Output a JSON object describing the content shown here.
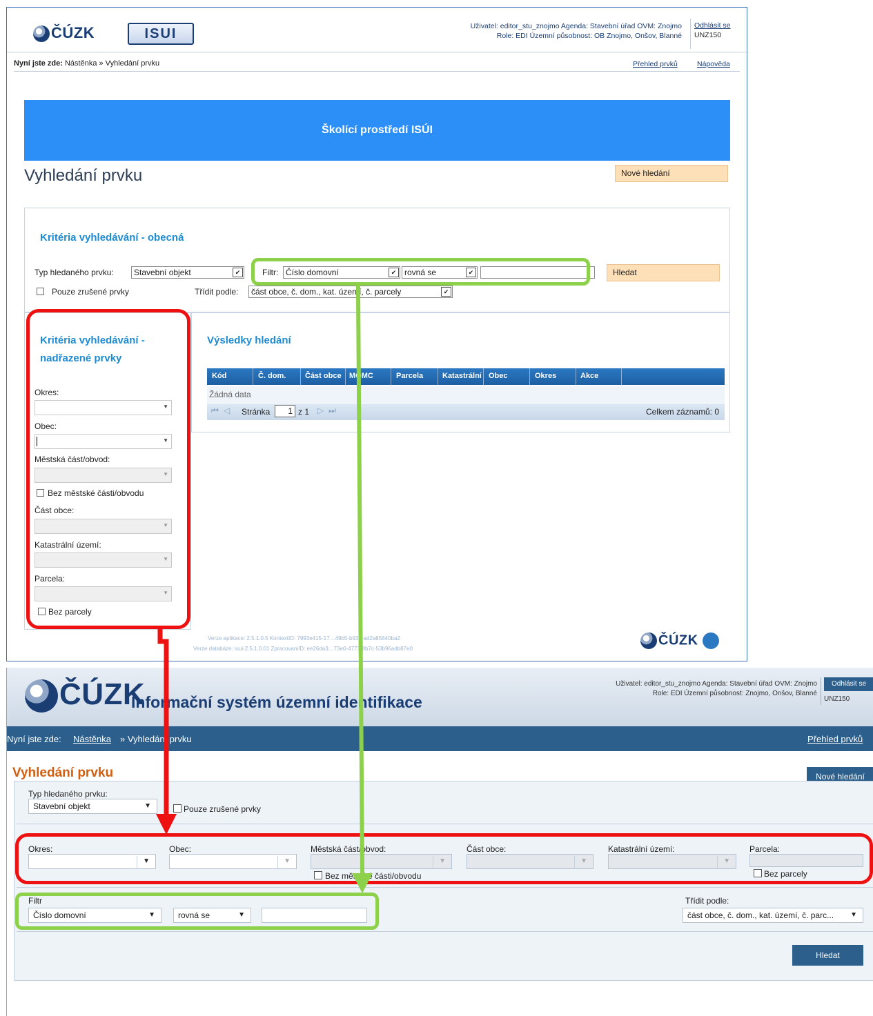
{
  "old_ui": {
    "logo_text": "ČÚZK",
    "app_logo": "ISUI",
    "user_line1": "Uživatel: editor_stu_znojmo   Agenda: Stavební úřad   OVM: Znojmo",
    "user_line2": "Role: EDI   Územní působnost: OB Znojmo, Onšov, Blanné",
    "logout": "Odhlásit se",
    "user_code": "UNZ150",
    "breadcrumb_prefix": "Nyní jste zde:",
    "breadcrumb_path": "Nástěnka » Vyhledání prvku",
    "link_overview": "Přehled prvků",
    "link_help": "Nápověda",
    "banner": "Školící prostředí ISÚI",
    "page_title": "Vyhledání prvku",
    "new_search": "Nové hledání",
    "general_title": "Kritéria vyhledávání - obecná",
    "type_label": "Typ hledaného prvku:",
    "type_value": "Stavební objekt",
    "filter_label": "Filtr:",
    "filter_value": "Číslo domovní",
    "operator_value": "rovná se",
    "search_button": "Hledat",
    "cancelled_only": "Pouze zrušené prvky",
    "sort_label": "Třídit podle:",
    "sort_value": "část obce, č. dom., kat. území, č. parcely",
    "parent_title_1": "Kritéria vyhledávání -",
    "parent_title_2": "nadřazené prvky",
    "okres": "Okres:",
    "obec": "Obec:",
    "mestska_cast": "Městská část/obvod:",
    "bez_mestske": "Bez městské části/obvodu",
    "cast_obce": "Část obce:",
    "kat_uzemi": "Katastrální území:",
    "parcela": "Parcela:",
    "bez_parcely": "Bez parcely",
    "results_title": "Výsledky hledání",
    "columns": [
      "Kód",
      "Č. dom.",
      "Část obce",
      "MOMC",
      "Parcela",
      "Katastrální",
      "Obec",
      "Okres",
      "Akce"
    ],
    "no_data": "Žádná data",
    "page_label": "Stránka",
    "page_value": "1",
    "page_of": "z 1",
    "total": "Celkem záznamů: 0",
    "footer1": "Verze aplikace: 2.5.1.0.5 KontextID: 7993e415-17…49b5-b93a-ad2a85640ba2",
    "footer2": "Verze databáze: isui-2.5.1.0.01 ZpracovaniID: ee26da3…73e0-4771-8b7c-53b96adb87e0",
    "footer_logo": "ČÚZK"
  },
  "new_ui": {
    "logo_text": "ČÚZK",
    "app_title": "Informační systém územní identifikace",
    "user_line1": "Uživatel: editor_stu_znojmo     Agenda: Stavební úřad     OVM: Znojmo",
    "user_line2": "Role: EDI     Územní působnost: Znojmo, Onšov, Blanné",
    "logout": "Odhlásit se",
    "user_code": "UNZ150",
    "breadcrumb_prefix": "Nyní jste zde:",
    "breadcrumb_link": "Nástěnka",
    "breadcrumb_current": "» Vyhledání prvku",
    "link_overview": "Přehled prvků",
    "page_title": "Vyhledání prvku",
    "new_search": "Nové hledání",
    "type_label": "Typ hledaného prvku:",
    "type_value": "Stavební objekt",
    "cancelled_only": "Pouze zrušené prvky",
    "okres": "Okres:",
    "obec": "Obec:",
    "mestska_cast": "Městská část/obvod:",
    "bez_mestske": "Bez městské části/obvodu",
    "cast_obce": "Část obce:",
    "kat_uzemi": "Katastrální území:",
    "parcela": "Parcela:",
    "bez_parcely": "Bez parcely",
    "filter_label": "Filtr",
    "filter_value": "Číslo domovní",
    "operator_value": "rovná se",
    "sort_label": "Třídit podle:",
    "sort_value": "část obce, č. dom., kat. území, č. parc...",
    "search_button": "Hledat"
  },
  "colors": {
    "annotation_red": "#ee1111",
    "annotation_green": "#8dd14b",
    "banner_blue": "#2b8ff7",
    "nav_blue": "#2d5f8c",
    "title_orange": "#d25e10"
  }
}
